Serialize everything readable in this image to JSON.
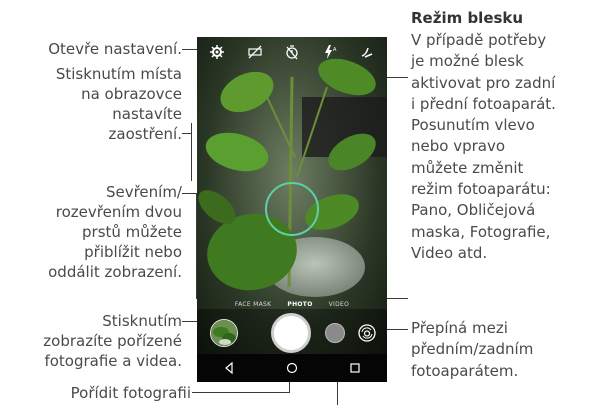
{
  "annotations": {
    "settings": "Otevře nastavení.",
    "focus": "Stisknutím místa\nna obrazovce\nnastavíte\nzaostření.",
    "zoom": "Sevřením/\nrozevřením dvou\nprstů můžete\npřiblížit nebo\noddálit zobrazení.",
    "gallery": "Stisknutím\nzobrazíte pořízené\nfotografie a videa.",
    "shutter": "Pořídit fotografii",
    "flash_title": "Režim blesku",
    "flash_body": "V případě potřeby\nje možné blesk\naktivovat pro zadní\ni přední fotoaparát.\nPosunutím vlevo\nnebo vpravo\nmůžete změnit\nrežim fotoaparátu:\nPano, Obličejová\nmaska, Fotografie,\nVideo atd.",
    "switch_camera": "Přepíná mezi\npředním/zadním\nfotoaparátem."
  },
  "camera": {
    "modes": [
      "FACE MASK",
      "PHOTO",
      "VIDEO"
    ],
    "active_mode": "PHOTO",
    "top_icons": [
      "settings-icon",
      "hdr-off-icon",
      "timer-off-icon",
      "flash-auto-icon",
      "beauty-icon"
    ],
    "nav_icons": [
      "back-icon",
      "home-icon",
      "recents-icon"
    ]
  },
  "colors": {
    "focus_ring": "#5ed0a6",
    "text": "#4a4a4a",
    "leaf_green": "#4c8c2b"
  }
}
